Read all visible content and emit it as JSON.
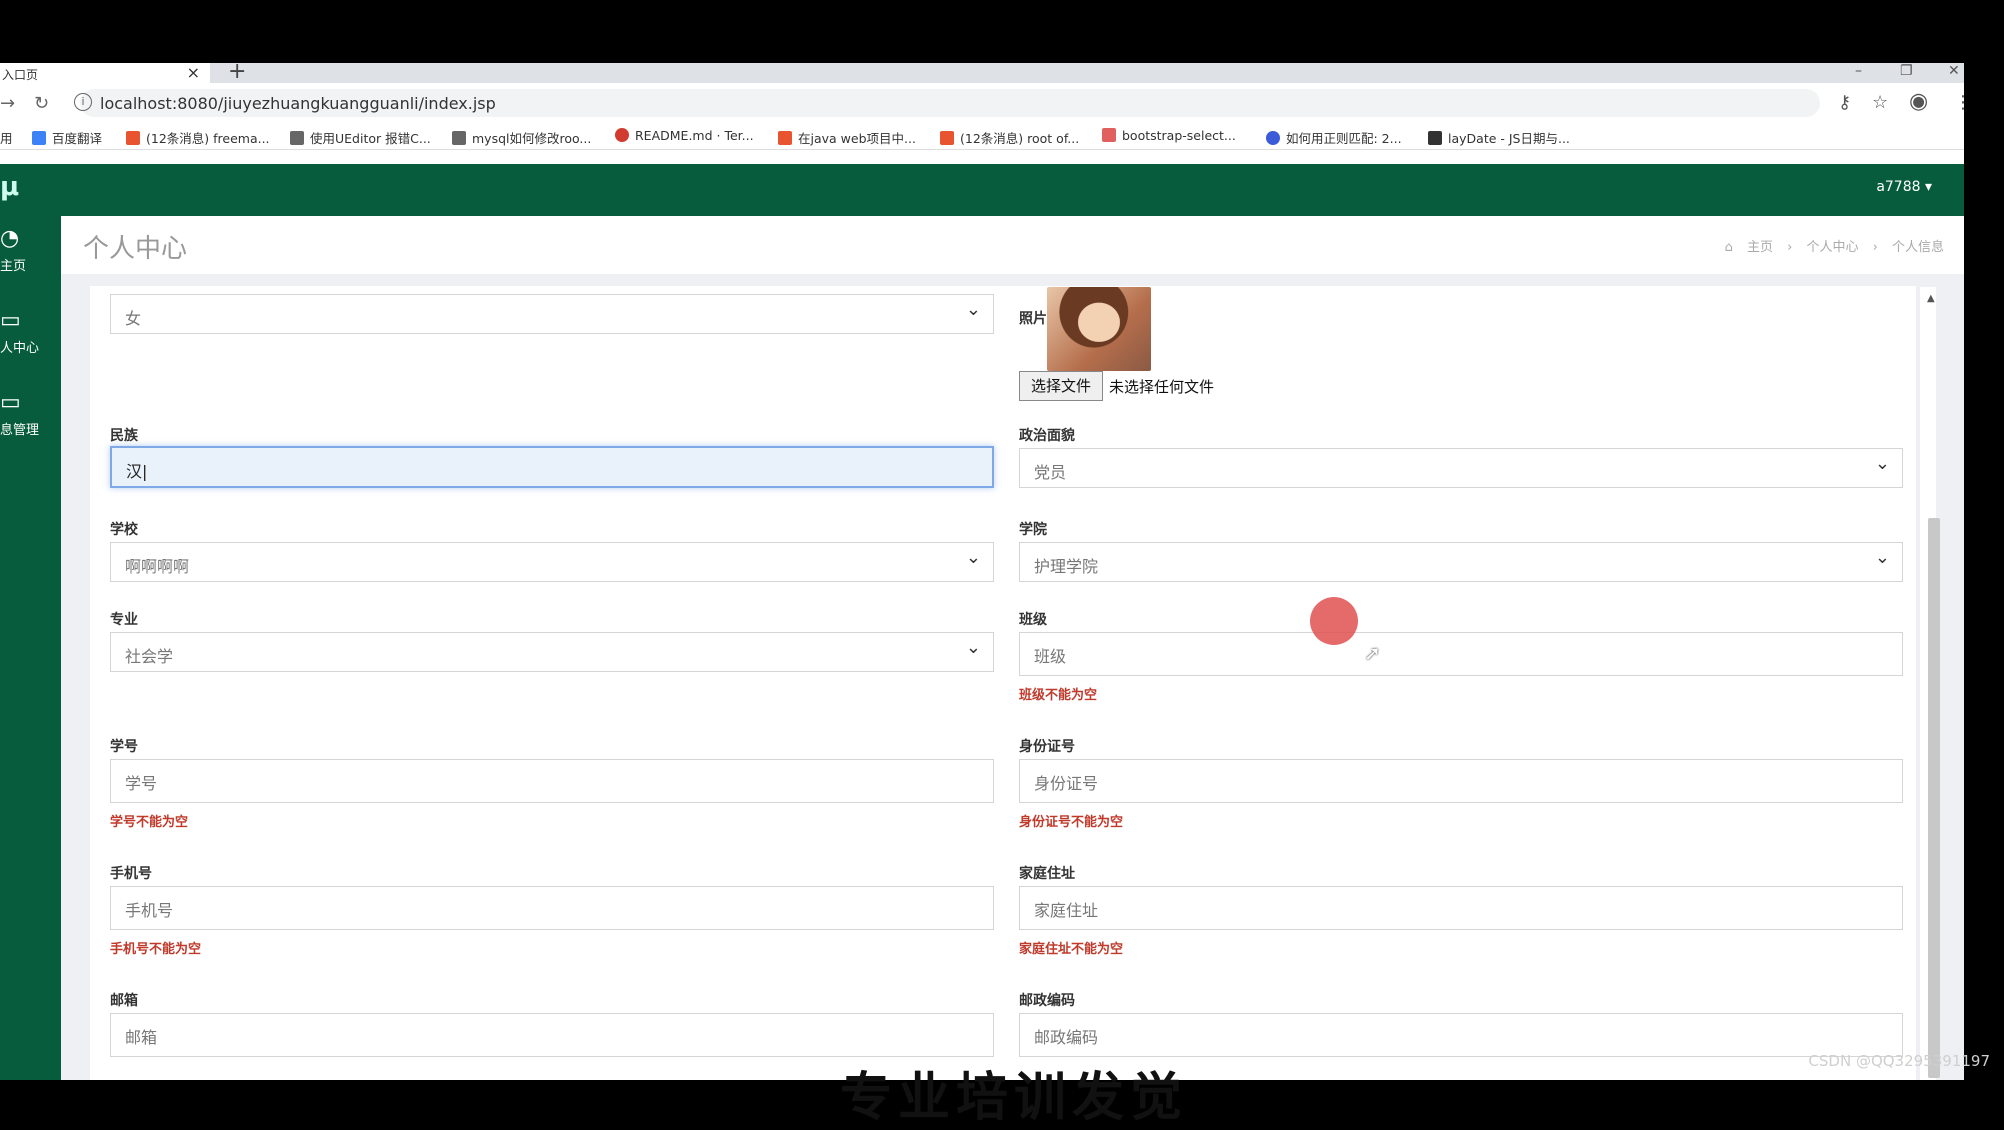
{
  "browser": {
    "tab_title": "入口页",
    "tab_close": "×",
    "new_tab": "+",
    "url": "localhost:8080/jiuyezhuangkuangguanli/index.jsp",
    "bookmarks": [
      {
        "label": "用",
        "color": "#4a90d9"
      },
      {
        "label": "百度翻译",
        "color": "#3b82f6"
      },
      {
        "label": "(12条消息) freema...",
        "color": "#e8542f"
      },
      {
        "label": "使用UEditor 报错C...",
        "color": "#555555"
      },
      {
        "label": "mysql如何修改roo...",
        "color": "#555555"
      },
      {
        "label": "README.md · Ter...",
        "color": "#d23b2f"
      },
      {
        "label": "在java web项目中...",
        "color": "#e8542f"
      },
      {
        "label": "(12条消息) root of...",
        "color": "#e8542f"
      },
      {
        "label": "bootstrap-select...",
        "color": "#e06060"
      },
      {
        "label": "如何用正则匹配: 2...",
        "color": "#3b5bd9"
      },
      {
        "label": "layDate - JS日期与...",
        "color": "#333333"
      }
    ]
  },
  "app": {
    "logo": "μ",
    "user": "a7788 ▾",
    "sidebar": [
      {
        "icon": "dashboard-icon",
        "label": "主页"
      },
      {
        "icon": "monitor-icon",
        "label": "人中心"
      },
      {
        "icon": "monitor-icon",
        "label": "息管理"
      }
    ],
    "page_title": "个人中心",
    "breadcrumb": [
      "主页",
      "个人中心",
      "个人信息"
    ]
  },
  "form": {
    "gender_value": "女",
    "photo_label": "照片",
    "file_button": "选择文件",
    "file_status": "未选择任何文件",
    "ethnicity_label": "民族",
    "ethnicity_value": "汉",
    "politics_label": "政治面貌",
    "politics_value": "党员",
    "school_label": "学校",
    "school_value": "啊啊啊啊",
    "college_label": "学院",
    "college_value": "护理学院",
    "major_label": "专业",
    "major_value": "社会学",
    "class_label": "班级",
    "class_placeholder": "班级",
    "class_error": "班级不能为空",
    "student_id_label": "学号",
    "student_id_placeholder": "学号",
    "student_id_error": "学号不能为空",
    "id_card_label": "身份证号",
    "id_card_placeholder": "身份证号",
    "id_card_error": "身份证号不能为空",
    "phone_label": "手机号",
    "phone_placeholder": "手机号",
    "phone_error": "手机号不能为空",
    "address_label": "家庭住址",
    "address_placeholder": "家庭住址",
    "address_error": "家庭住址不能为空",
    "email_label": "邮箱",
    "email_placeholder": "邮箱",
    "postcode_label": "邮政编码",
    "postcode_placeholder": "邮政编码"
  },
  "overlay": {
    "caption": "专业培训发觉",
    "watermark": "CSDN @QQ3295391197"
  }
}
